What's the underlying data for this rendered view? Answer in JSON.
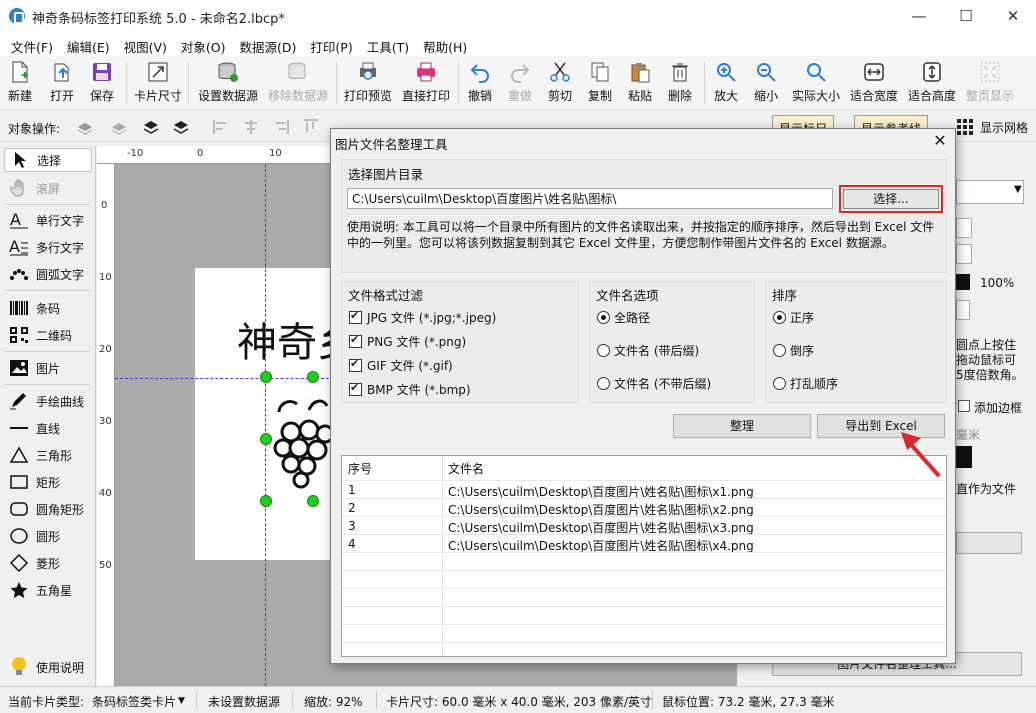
{
  "window": {
    "title": "神奇条码标签打印系统 5.0 - 未命名2.lbcp*",
    "minimize": "—",
    "maximize": "☐",
    "close": "✕"
  },
  "menu": [
    "文件(F)",
    "编辑(E)",
    "视图(V)",
    "对象(O)",
    "数据源(D)",
    "打印(P)",
    "工具(T)",
    "帮助(H)"
  ],
  "toolbar": {
    "new": "新建",
    "open": "打开",
    "save": "保存",
    "card_size": "卡片尺寸",
    "set_datasource": "设置数据源",
    "remove_datasource": "移除数据源",
    "print_preview": "打印预览",
    "direct_print": "直接打印",
    "undo": "撤销",
    "redo": "重做",
    "cut": "剪切",
    "copy": "复制",
    "paste": "粘贴",
    "delete": "删除",
    "zoom_in": "放大",
    "zoom_out": "缩小",
    "actual_size": "实际大小",
    "fit_width": "适合宽度",
    "fit_height": "适合高度",
    "fit_page": "整页显示"
  },
  "objbar": {
    "label": "对象操作:",
    "show_ruler": "显示标尺",
    "show_guides": "显示参考线",
    "show_grid": "显示网格"
  },
  "tools": {
    "select": "选择",
    "scroll": "滚屏",
    "single_text": "单行文字",
    "multi_text": "多行文字",
    "arc_text": "圆弧文字",
    "barcode": "条码",
    "qrcode": "二维码",
    "image": "图片",
    "freehand": "手绘曲线",
    "line": "直线",
    "triangle": "三角形",
    "rectangle": "矩形",
    "round_rect": "圆角矩形",
    "circle": "圆形",
    "diamond": "菱形",
    "star": "五角星",
    "help": "使用说明"
  },
  "ruler": {
    "h": [
      "-10",
      "0",
      "10",
      "20"
    ],
    "v": [
      "0",
      "10",
      "20",
      "30",
      "40",
      "50"
    ]
  },
  "canvas": {
    "label_text": "神奇乡"
  },
  "rightpanel": {
    "percent": "100%",
    "hint1": "圆点上按住",
    "hint2": "拖动鼠标可",
    "hint3": "5度倍数角。",
    "add_border": "添加边框",
    "unit": "毫米",
    "save_as_file": "直作为文件",
    "bottom_btn": "图片文件名整理工具..."
  },
  "status": {
    "card_type_label": "当前卡片类型:",
    "card_type": "条码标签类卡片",
    "datasource": "未设置数据源",
    "zoom": "缩放: 92%",
    "card_size": "卡片尺寸: 60.0 毫米 x 40.0 毫米, 203 像素/英寸",
    "mouse_pos": "鼠标位置: 73.2 毫米, 27.3 毫米"
  },
  "dialog": {
    "title": "图片文件名整理工具",
    "dir_group": "选择图片目录",
    "path": "C:\\Users\\cuilm\\Desktop\\百度图片\\姓名贴\\图标\\",
    "choose_btn": "选择...",
    "desc": "使用说明: 本工具可以将一个目录中所有图片的文件名读取出来，并按指定的顺序排序，然后导出到 Excel 文件中的一列里。您可以将该列数据复制到其它 Excel 文件里，方便您制作带图片文件名的 Excel 数据源。",
    "format_group": "文件格式过滤",
    "formats": [
      {
        "label": "JPG 文件 (*.jpg;*.jpeg)",
        "checked": true
      },
      {
        "label": "PNG 文件 (*.png)",
        "checked": true
      },
      {
        "label": "GIF 文件 (*.gif)",
        "checked": true
      },
      {
        "label": "BMP 文件 (*.bmp)",
        "checked": true
      }
    ],
    "name_group": "文件名选项",
    "name_options": [
      {
        "label": "全路径",
        "selected": true
      },
      {
        "label": "文件名 (带后缀)",
        "selected": false
      },
      {
        "label": "文件名 (不带后缀)",
        "selected": false
      }
    ],
    "sort_group": "排序",
    "sort_options": [
      {
        "label": "正序",
        "selected": true
      },
      {
        "label": "倒序",
        "selected": false
      },
      {
        "label": "打乱顺序",
        "selected": false
      }
    ],
    "organize_btn": "整理",
    "export_btn": "导出到 Excel",
    "table": {
      "headers": [
        "序号",
        "文件名"
      ],
      "rows": [
        [
          "1",
          "C:\\Users\\cuilm\\Desktop\\百度图片\\姓名贴\\图标\\x1.png"
        ],
        [
          "2",
          "C:\\Users\\cuilm\\Desktop\\百度图片\\姓名贴\\图标\\x2.png"
        ],
        [
          "3",
          "C:\\Users\\cuilm\\Desktop\\百度图片\\姓名贴\\图标\\x3.png"
        ],
        [
          "4",
          "C:\\Users\\cuilm\\Desktop\\百度图片\\姓名贴\\图标\\x4.png"
        ]
      ]
    }
  },
  "colors": {
    "accent": "#2a7fd4",
    "highlight": "#d42a2a",
    "handle": "#22cc22",
    "guide": "#3a3adf"
  }
}
